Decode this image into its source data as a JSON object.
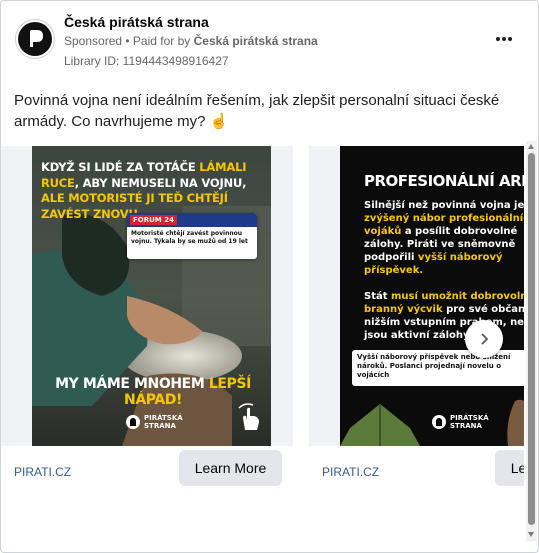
{
  "post": {
    "page_name": "Česká pirátská strana",
    "sponsored": "Sponsored",
    "paid_for_prefix": "• Paid for by",
    "paid_for_by": "Česká pirátská strana",
    "library_id": "Library ID: 1194443498916427",
    "more_icon": "more-horizontal-icon",
    "body_text": "Povinná vojna není ideálním řešením, jak zlepšit personalní situaci české armády. Co navrhujeme my? ☝️"
  },
  "carousel": {
    "cards": [
      {
        "creative": {
          "top_line1": "KDYŽ SI LIDÉ ZA TOTÁČE",
          "top_hl1": "LÁMALI RUCE",
          "top_line2": ", ABY NEMUSELI NA VOJNU,",
          "top_hl2": "ALE MOTORISTÉ JI TEĎ CHTĚJÍ ZAVÉST ZNOVU...",
          "forum_logo": "FORUM 24",
          "forum_text": "Motoristé chtějí zavést povinnou vojnu. Týkala by se mužů od 19 let",
          "bottom_white": "MY MÁME MNOHEM",
          "bottom_yellow": "LEPŠÍ NÁPAD!",
          "brand": "PIRÁTSKÁ STRANA"
        },
        "site": "PIRATI.CZ",
        "cta": "Learn More"
      },
      {
        "creative": {
          "title": "PROFESIONÁLNÍ ARMÁDA",
          "p1_white": "Silnější než povinná vojna je",
          "p1_yellow": "zvýšený nábor profesionálních vojáků",
          "p1_rest": "a posílit dobrovolné zálohy. Piráti ve sněmovně podpořili",
          "p1_yellow2": "vyšší náborový příspěvek.",
          "p2_white": "Stát",
          "p2_yellow": "musí umožnit dobrovolný branný výcvik",
          "p2_rest": "pro své občany s nižším vstupním prahem, než jsou aktivní zálohy.",
          "box_text": "Vyšší náborový příspěvek nebo snížení nároků. Poslanci projednají novelu o vojácích",
          "brand": "PIRÁTSKÁ STRANA"
        },
        "site": "PIRATI.CZ",
        "cta": "Learn More"
      }
    ],
    "next_icon": "chevron-right-icon"
  },
  "colors": {
    "accent_yellow": "#f7c800",
    "link_blue": "#385898",
    "button_gray": "#e4e6eb"
  }
}
